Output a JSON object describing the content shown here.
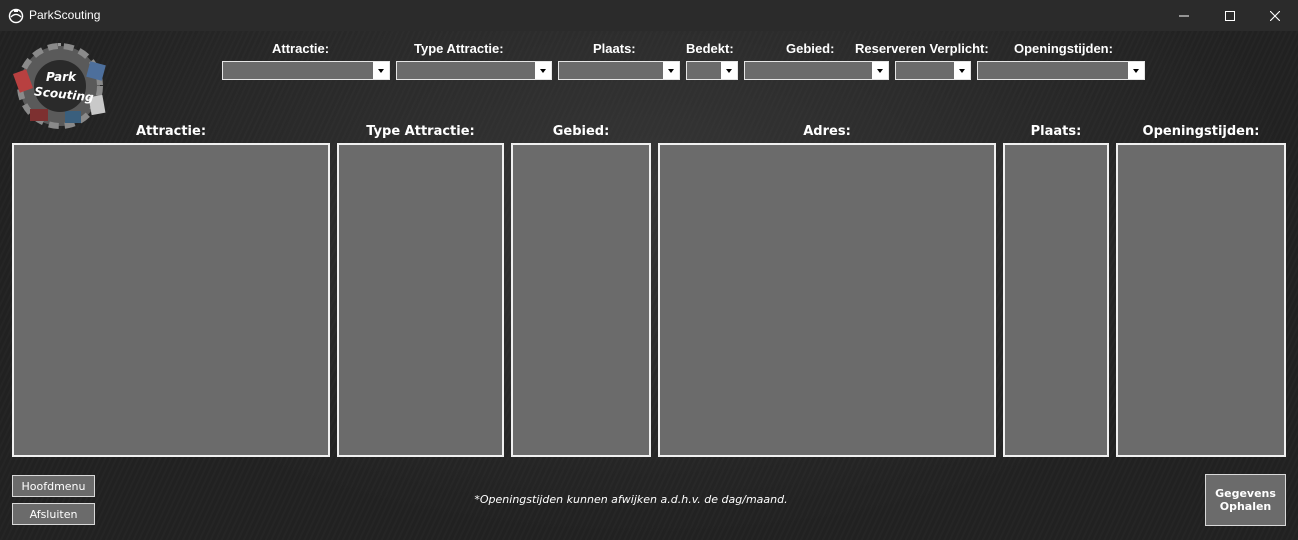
{
  "window": {
    "title": "ParkScouting",
    "controls": [
      "minimize",
      "maximize",
      "close"
    ]
  },
  "logo": {
    "line1": "Park",
    "line2": "Scouting"
  },
  "filters": [
    {
      "label": "Attractie:",
      "value": ""
    },
    {
      "label": "Type Attractie:",
      "value": ""
    },
    {
      "label": "Plaats:",
      "value": ""
    },
    {
      "label": "Bedekt:",
      "value": ""
    },
    {
      "label": "Gebied:",
      "value": ""
    },
    {
      "label": "Reserveren Verplicht:",
      "value": ""
    },
    {
      "label": "Openingstijden:",
      "value": ""
    }
  ],
  "columns": [
    {
      "label": "Attractie:",
      "items": []
    },
    {
      "label": "Type Attractie:",
      "items": []
    },
    {
      "label": "Gebied:",
      "items": []
    },
    {
      "label": "Adres:",
      "items": []
    },
    {
      "label": "Plaats:",
      "items": []
    },
    {
      "label": "Openingstijden:",
      "items": []
    }
  ],
  "buttons": {
    "main_menu": "Hoofdmenu",
    "exit": "Afsluiten",
    "fetch_line1": "Gegevens",
    "fetch_line2": "Ophalen"
  },
  "note": "*Openingstijden kunnen afwijken a.d.h.v. de dag/maand.",
  "colors": {
    "background": "#222222",
    "titlebar": "#2b2b2b",
    "control_fill": "#6b6b6b",
    "text": "#ffffff"
  }
}
